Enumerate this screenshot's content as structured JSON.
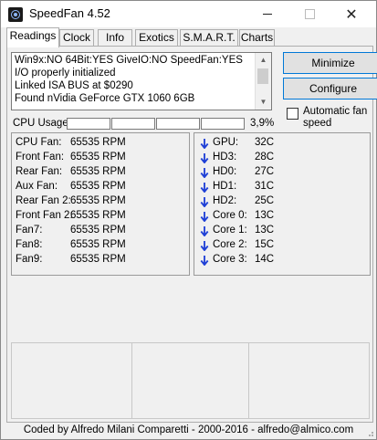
{
  "window": {
    "title": "SpeedFan 4.52"
  },
  "tabs": [
    {
      "label": "Readings"
    },
    {
      "label": "Clock"
    },
    {
      "label": "Info"
    },
    {
      "label": "Exotics"
    },
    {
      "label": "S.M.A.R.T."
    },
    {
      "label": "Charts"
    }
  ],
  "log": {
    "lines": [
      "Win9x:NO  64Bit:YES  GiveIO:NO  SpeedFan:YES",
      "I/O properly initialized",
      "Linked ISA BUS at $0290",
      "Found nVidia GeForce GTX 1060 6GB"
    ]
  },
  "buttons": {
    "minimize": "Minimize",
    "configure": "Configure"
  },
  "auto_fan": {
    "label": "Automatic fan speed",
    "checked": false
  },
  "cpu": {
    "label": "CPU Usage",
    "percent": "3,9%",
    "cores": [
      0.0,
      0.0,
      0.0,
      0.0
    ]
  },
  "fans": [
    {
      "name": "CPU Fan:",
      "value": "65535 RPM"
    },
    {
      "name": "Front Fan:",
      "value": "65535 RPM"
    },
    {
      "name": "Rear Fan:",
      "value": "65535 RPM"
    },
    {
      "name": "Aux Fan:",
      "value": "65535 RPM"
    },
    {
      "name": "Rear Fan 2:",
      "value": "65535 RPM"
    },
    {
      "name": "Front Fan 2:",
      "value": "65535 RPM"
    },
    {
      "name": "Fan7:",
      "value": "65535 RPM"
    },
    {
      "name": "Fan8:",
      "value": "65535 RPM"
    },
    {
      "name": "Fan9:",
      "value": "65535 RPM"
    }
  ],
  "temps": [
    {
      "name": "GPU:",
      "value": "32C"
    },
    {
      "name": "HD3:",
      "value": "28C"
    },
    {
      "name": "HD0:",
      "value": "27C"
    },
    {
      "name": "HD1:",
      "value": "31C"
    },
    {
      "name": "HD2:",
      "value": "25C"
    },
    {
      "name": "Core 0:",
      "value": "13C"
    },
    {
      "name": "Core 1:",
      "value": "13C"
    },
    {
      "name": "Core 2:",
      "value": "15C"
    },
    {
      "name": "Core 3:",
      "value": "14C"
    }
  ],
  "colors": {
    "arrow": "#1e3fd6",
    "button_border": "#0078d7"
  },
  "status": "Coded by Alfredo Milani Comparetti - 2000-2016 - alfredo@almico.com"
}
